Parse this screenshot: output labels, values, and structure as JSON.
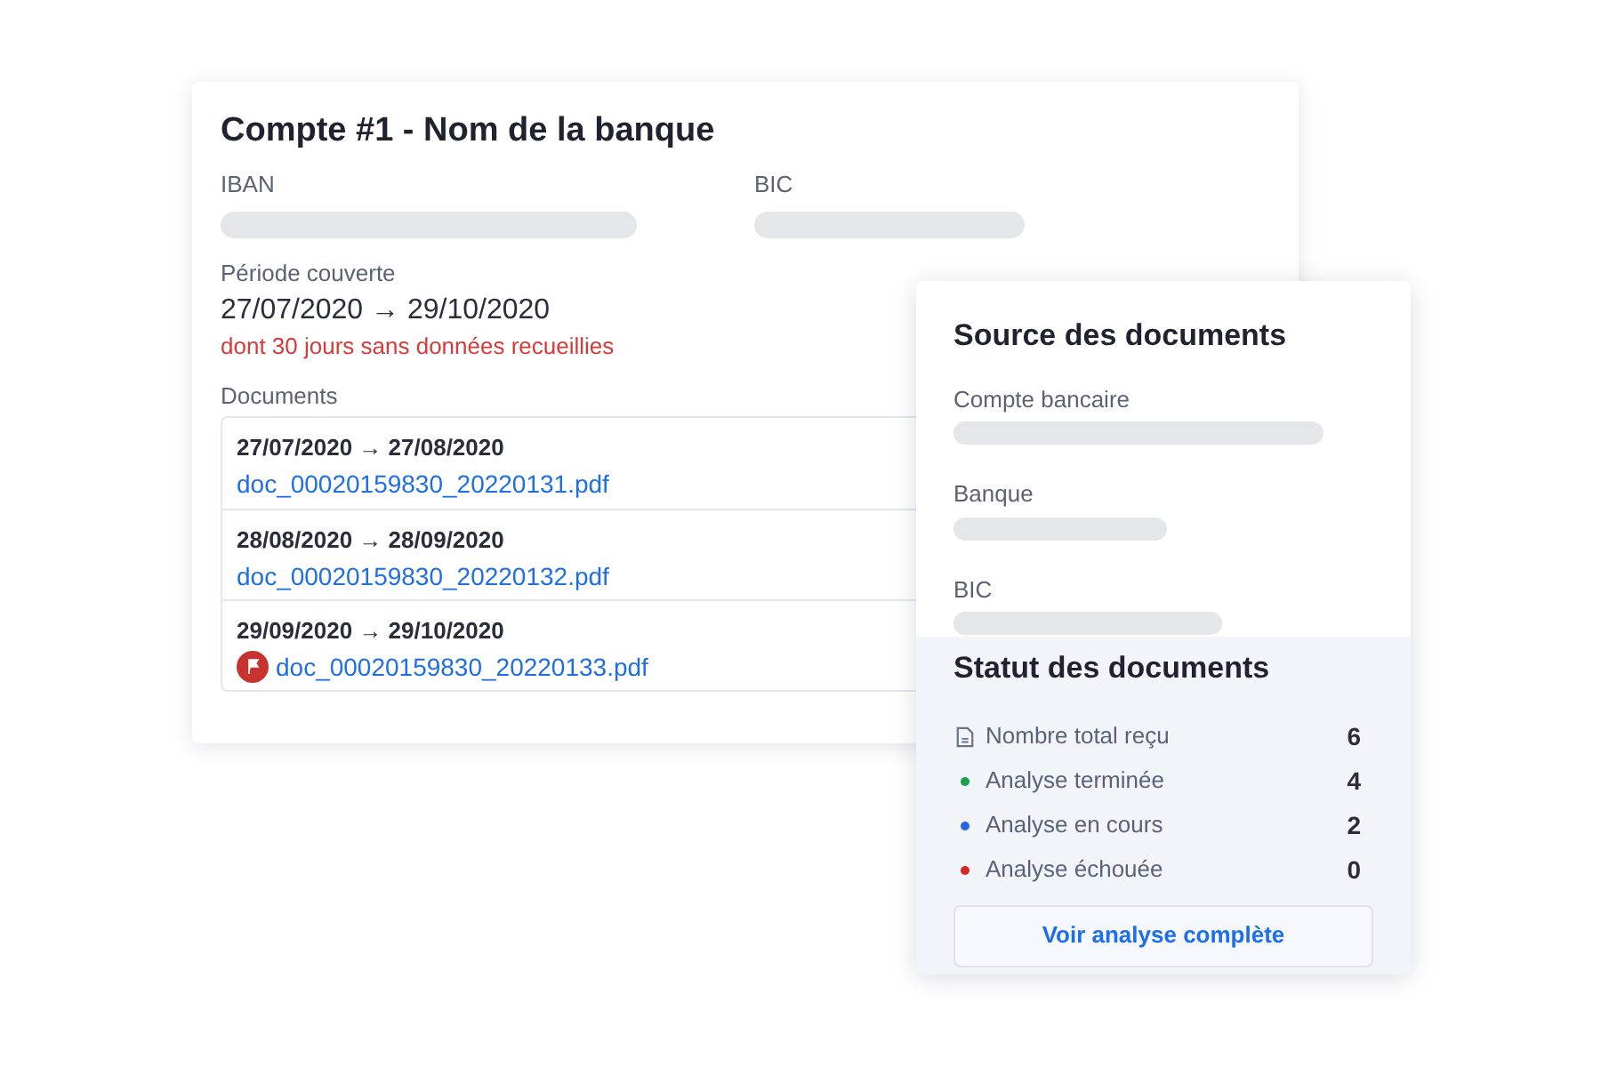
{
  "account": {
    "title": "Compte #1 - Nom de la banque",
    "iban_label": "IBAN",
    "bic_label": "BIC",
    "period_label": "Période couverte",
    "period": "27/07/2020 → 29/10/2020",
    "period_warning": "dont 30 jours sans données recueillies",
    "documents_label": "Documents",
    "documents": [
      {
        "range": "27/07/2020 → 27/08/2020",
        "file": "doc_00020159830_20220131.pdf",
        "flagged": false
      },
      {
        "range": "28/08/2020 → 28/09/2020",
        "file": "doc_00020159830_20220132.pdf",
        "flagged": false
      },
      {
        "range": "29/09/2020 → 29/10/2020",
        "file": "doc_00020159830_20220133.pdf",
        "flagged": true
      }
    ]
  },
  "source": {
    "title": "Source des documents",
    "fields": [
      "Compte bancaire",
      "Banque",
      "BIC"
    ]
  },
  "status": {
    "title": "Statut des documents",
    "items": [
      {
        "kind": "total",
        "label": "Nombre total reçu",
        "count": "6"
      },
      {
        "kind": "dot",
        "color": "#16a34a",
        "label": "Analyse terminée",
        "count": "4"
      },
      {
        "kind": "dot",
        "color": "#2563eb",
        "label": "Analyse en cours",
        "count": "2"
      },
      {
        "kind": "dot",
        "color": "#dc2626",
        "label": "Analyse échouée",
        "count": "0"
      }
    ],
    "button": "Voir analyse complète"
  }
}
